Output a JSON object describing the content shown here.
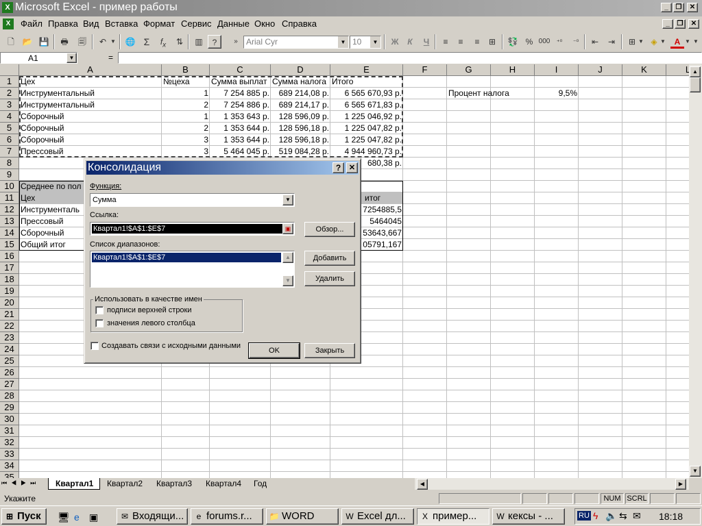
{
  "window": {
    "title": "Microsoft Excel - пример работы",
    "app_icon": "excel-icon"
  },
  "menu": [
    "Файл",
    "Правка",
    "Вид",
    "Вставка",
    "Формат",
    "Сервис",
    "Данные",
    "Окно",
    "Справка"
  ],
  "toolbar": {
    "font": "Arial Cyr",
    "size": "10",
    "bold": "Ж",
    "italic": "К",
    "underline": "Ч",
    "percent": "%",
    "thousands": "000"
  },
  "formula_bar": {
    "name_box": "A1",
    "eq": "="
  },
  "columns": [
    "A",
    "B",
    "C",
    "D",
    "E",
    "F",
    "G",
    "H",
    "I",
    "J",
    "K",
    "L"
  ],
  "rows": [
    "1",
    "2",
    "3",
    "4",
    "5",
    "6",
    "7",
    "8",
    "9",
    "10",
    "11",
    "12",
    "13",
    "14",
    "15",
    "16",
    "17",
    "18",
    "19",
    "20",
    "21",
    "22",
    "23",
    "24",
    "25",
    "26",
    "27",
    "28",
    "29",
    "30",
    "31",
    "32",
    "33",
    "34",
    "35"
  ],
  "table": {
    "header": [
      "Цех",
      "№цеха",
      "Сумма выплат",
      "Сумма налога",
      "Итого"
    ],
    "rows": [
      [
        "Инструментальный",
        "1",
        "7 254 885 р.",
        "689 214,08 р.",
        "6 565 670,93 р."
      ],
      [
        "Инструментальный",
        "2",
        "7 254 886 р.",
        "689 214,17 р.",
        "6 565 671,83 р."
      ],
      [
        "Сборочный",
        "1",
        "1 353 643 р.",
        "128 596,09 р.",
        "1 225 046,92 р."
      ],
      [
        "Сборочный",
        "2",
        "1 353 644 р.",
        "128 596,18 р.",
        "1 225 047,82 р."
      ],
      [
        "Сборочный",
        "3",
        "1 353 644 р.",
        "128 596,18 р.",
        "1 225 047,82 р."
      ],
      [
        "Прессовый",
        "3",
        "5 464 045 р.",
        "519 084,28 р.",
        "4 944 960,73 р."
      ]
    ],
    "row8_partial": "680,38 р."
  },
  "tax": {
    "label": "Процент налога",
    "value": "9,5%"
  },
  "pivot": {
    "title": "Среднее по пол",
    "col_header": "Цех",
    "total_header": "итог",
    "rows": [
      {
        "label": "Инструменталь",
        "value": "7254885,5"
      },
      {
        "label": "Прессовый",
        "value": "5464045"
      },
      {
        "label": "Сборочный",
        "value": "53643,667"
      },
      {
        "label": "Общий итог",
        "value": "05791,167"
      }
    ]
  },
  "dialog": {
    "title": "Консолидация",
    "help": "?",
    "close": "✕",
    "function_label": "Функция:",
    "function_value": "Сумма",
    "ref_label": "Ссылка:",
    "ref_value": "Квартал1!$A$1:$E$7",
    "browse": "Обзор...",
    "ranges_label": "Список диапазонов:",
    "ranges": [
      "Квартал1!$A$1:$E$7"
    ],
    "add": "Добавить",
    "delete": "Удалить",
    "names_group": "Использовать в качестве имен",
    "top_row": "подписи верхней строки",
    "left_col": "значения левого столбца",
    "links": "Создавать связи с исходными данными",
    "ok": "OK",
    "close_btn": "Закрыть"
  },
  "sheets": [
    "Квартал1",
    "Квартал2",
    "Квартал3",
    "Квартал4",
    "Год"
  ],
  "status": {
    "text": "Укажите",
    "num": "NUM",
    "scrl": "SCRL"
  },
  "taskbar": {
    "start": "Пуск",
    "tasks": [
      "Входящи...",
      "forums.r...",
      "WORD",
      "Excel дл...",
      "пример...",
      "кексы - ..."
    ],
    "lang": "RU",
    "clock": "18:18"
  }
}
